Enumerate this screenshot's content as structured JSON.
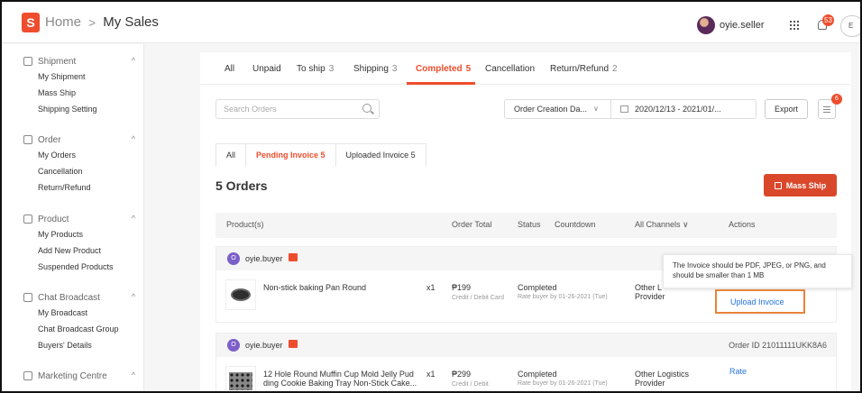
{
  "header": {
    "logo_letter": "S",
    "breadcrumb_home": "Home",
    "breadcrumb_sep": ">",
    "breadcrumb_current": "My Sales",
    "username": "oyie.seller",
    "notification_count": "53",
    "lang_label": "E"
  },
  "sidebar": {
    "sections": [
      {
        "title": "Shipment",
        "items": [
          "My Shipment",
          "Mass Ship",
          "Shipping Setting"
        ]
      },
      {
        "title": "Order",
        "items": [
          "My Orders",
          "Cancellation",
          "Return/Refund"
        ]
      },
      {
        "title": "Product",
        "items": [
          "My Products",
          "Add New Product",
          "Suspended Products"
        ]
      },
      {
        "title": "Chat Broadcast",
        "items": [
          "My Broadcast",
          "Chat Broadcast Group",
          "Buyers' Details"
        ]
      },
      {
        "title": "Marketing Centre",
        "items": []
      }
    ],
    "caret": "^"
  },
  "tabs": [
    {
      "label": "All",
      "count": ""
    },
    {
      "label": "Unpaid",
      "count": ""
    },
    {
      "label": "To ship",
      "count": "3"
    },
    {
      "label": "Shipping",
      "count": "3"
    },
    {
      "label": "Completed",
      "count": "5"
    },
    {
      "label": "Cancellation",
      "count": ""
    },
    {
      "label": "Return/Refund",
      "count": "2"
    }
  ],
  "filters": {
    "search_placeholder": "Search Orders",
    "date_type": "Order Creation Da...",
    "date_chevron": "∨",
    "date_range": "2020/12/13 - 2021/01/...",
    "export_label": "Export",
    "filter_badge": "6"
  },
  "subtabs": [
    "All",
    "Pending Invoice 5",
    "Uploaded Invoice 5"
  ],
  "orders_title": "5 Orders",
  "mass_ship_label": "Mass Ship",
  "table_headers": {
    "products": "Product(s)",
    "order_total": "Order Total",
    "status": "Status",
    "countdown": "Countdown",
    "channels": "All Channels ∨",
    "actions": "Actions"
  },
  "orders": [
    {
      "buyer_initial": "O",
      "buyer": "oyie.buyer",
      "order_id": "",
      "product_name": "Non-stick baking Pan Round",
      "qty": "x1",
      "total": "₱199",
      "payment": "Credit / Debit Card",
      "status": "Completed",
      "rate_note": "Rate buyer by 01-26-2021 (Tue)",
      "logistics_1": "Other L",
      "logistics_2": "Provider",
      "action": "Upload Invoice"
    },
    {
      "buyer_initial": "O",
      "buyer": "oyie.buyer",
      "order_id": "Order ID 21011111UKK8A6",
      "product_name_1": "12 Hole Round Muffin Cup Mold Jelly Pud",
      "product_name_2": "ding Cookie Baking Tray Non-Stick Cake...",
      "qty": "x1",
      "total": "₱299",
      "payment": "Credit / Debit",
      "status": "Completed",
      "rate_note": "Rate buyer by 01-26-2021 (Tue)",
      "logistics_1": "Other Logistics",
      "logistics_2": "Provider",
      "action": "Rate"
    }
  ],
  "tooltip": "The Invoice should be PDF, JPEG, or PNG, and should be smaller than 1 MB",
  "colors": {
    "accent": "#ee4d2d",
    "link": "#2673dd",
    "highlight_box": "#e8843a"
  }
}
